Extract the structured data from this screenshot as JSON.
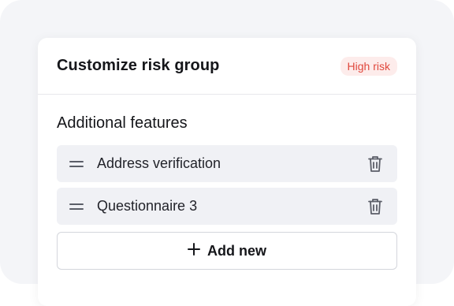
{
  "card": {
    "title": "Customize risk group",
    "badge": "High risk"
  },
  "additional_features": {
    "title": "Additional features",
    "items": [
      {
        "label": "Address verification"
      },
      {
        "label": "Questionnaire 3"
      }
    ],
    "add_label": "Add new"
  },
  "icons": {
    "drag": "drag-handle-icon",
    "delete": "trash-icon",
    "add": "plus-icon"
  },
  "colors": {
    "badge_bg": "#fdeceb",
    "badge_text": "#e0483d",
    "item_bg": "#f0f1f5",
    "text": "#15161a"
  }
}
